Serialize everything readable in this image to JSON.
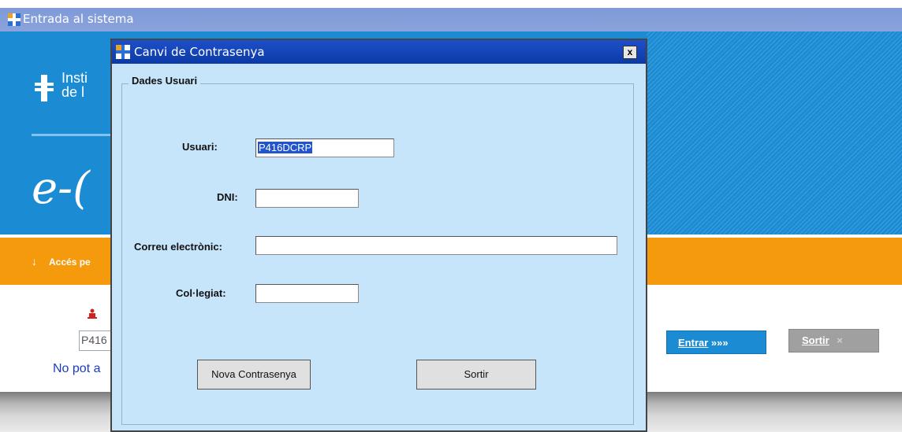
{
  "main_window": {
    "title": "Entrada al sistema",
    "banner_text": "Insti\nde l",
    "e_logo": "e-(",
    "access_label": "Accés pe",
    "login_value": "P416",
    "help_link": "No pot a",
    "enter_button": "Entrar",
    "enter_button_suffix": "»»»",
    "exit_button": "Sortir",
    "exit_icon": "×"
  },
  "dialog": {
    "title": "Canvi de Contrasenya",
    "close_label": "x",
    "group_label": "Dades Usuari",
    "fields": {
      "usuari_label": "Usuari:",
      "usuari_value": "P416DCRP",
      "dni_label": "DNI:",
      "dni_value": "",
      "email_label": "Correu electrònic:",
      "email_value": "",
      "collegiat_label": "Col·legiat:",
      "collegiat_value": ""
    },
    "buttons": {
      "new_password": "Nova Contrasenya",
      "exit": "Sortir"
    }
  },
  "colors": {
    "banner": "#1b8bd4",
    "orange_bar": "#f59a0d",
    "dialog_bg": "#c6e4fa",
    "dialog_title": "#0b3aa6"
  }
}
